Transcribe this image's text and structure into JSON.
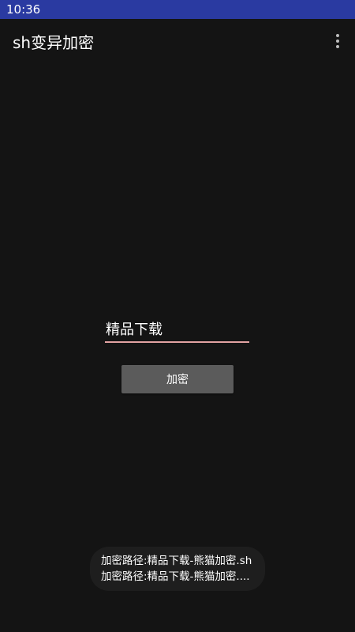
{
  "status_bar": {
    "time": "10:36",
    "color": "#2a3aa1"
  },
  "app_bar": {
    "title": "sh变异加密",
    "overflow_icon": "more-vert-icon"
  },
  "form": {
    "input_value": "精品下载",
    "underline_color": "#e2a3a3",
    "encrypt_label": "加密"
  },
  "toast": {
    "lines": [
      "加密路径:精品下载-熊猫加密.sh",
      "加密路径:精品下载-熊猫加密...."
    ]
  },
  "colors": {
    "background": "#141414",
    "button": "#5b5b5b"
  }
}
